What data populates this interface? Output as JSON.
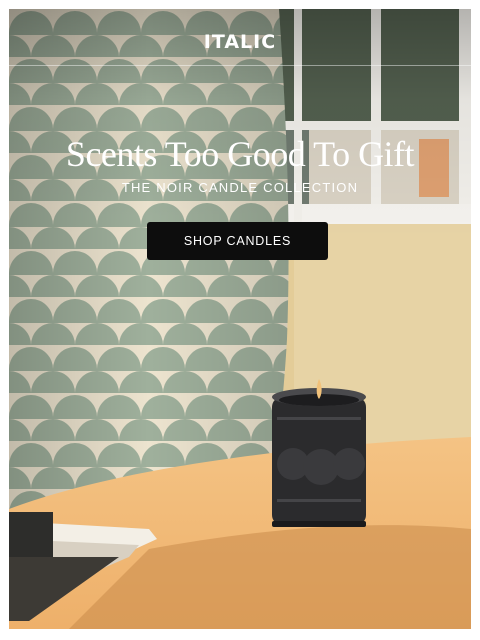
{
  "header": {
    "brand": "ITALIC"
  },
  "hero": {
    "headline": "Scents Too Good To Gift",
    "subheadline": "THE NOIR CANDLE COLLECTION",
    "cta_label": "SHOP CANDLES"
  },
  "colors": {
    "cta_background": "#0d0d0d",
    "text": "#ffffff",
    "curtain_cream": "#efe6d2",
    "curtain_sage": "#9fb3a0",
    "wall": "#e5cf9c",
    "table": "#f2b878"
  }
}
